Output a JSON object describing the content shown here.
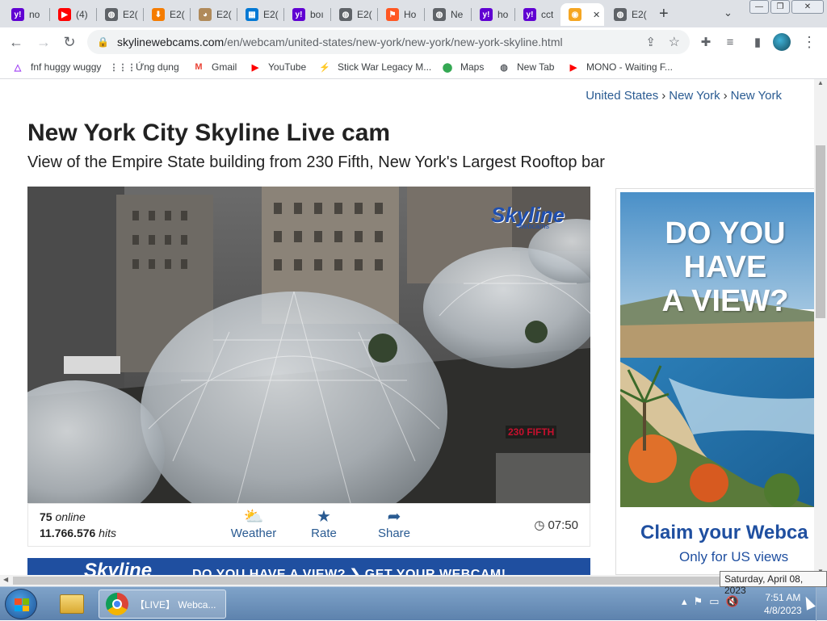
{
  "tabs": [
    {
      "title": "no",
      "icon": "yahoo-icon",
      "color": "#6001d2",
      "glyph": "y!"
    },
    {
      "title": "(4)",
      "icon": "youtube-icon",
      "color": "#ff0000",
      "glyph": "▶"
    },
    {
      "title": "E2(",
      "icon": "globe-icon",
      "color": "#5f6368",
      "glyph": "◍"
    },
    {
      "title": "E2(",
      "icon": "download-arrow-icon",
      "color": "#f57c00",
      "glyph": "⬇"
    },
    {
      "title": "E2(",
      "icon": "cat-icon",
      "color": "#b08a5a",
      "glyph": "◕"
    },
    {
      "title": "E2(",
      "icon": "windows-icon",
      "color": "#0078d4",
      "glyph": "▦"
    },
    {
      "title": "boı",
      "icon": "yahoo-icon",
      "color": "#6001d2",
      "glyph": "y!"
    },
    {
      "title": "E2(",
      "icon": "globe-icon",
      "color": "#5f6368",
      "glyph": "◍"
    },
    {
      "title": "Ho",
      "icon": "flag-icon",
      "color": "#ff5722",
      "glyph": "⚑"
    },
    {
      "title": "Ne",
      "icon": "globe-icon",
      "color": "#5f6368",
      "glyph": "◍"
    },
    {
      "title": "ho",
      "icon": "yahoo-icon",
      "color": "#6001d2",
      "glyph": "y!"
    },
    {
      "title": "cct",
      "icon": "yahoo-icon",
      "color": "#6001d2",
      "glyph": "y!"
    },
    {
      "title": "",
      "icon": "skyline-webcams-icon",
      "color": "#f5a623",
      "glyph": "◉",
      "active": true
    },
    {
      "title": "E2(",
      "icon": "globe-icon",
      "color": "#5f6368",
      "glyph": "◍"
    }
  ],
  "toolbar": {
    "url_domain": "skylinewebcams.com",
    "url_path": "/en/webcam/united-states/new-york/new-york/new-york-skyline.html"
  },
  "bookmarks": [
    {
      "label": "fnf huggy wuggy",
      "icon": "triangle-icon",
      "glyph": "△",
      "color": "#a142f4"
    },
    {
      "label": "Ứng dụng",
      "icon": "apps-grid-icon",
      "glyph": "⋮⋮⋮",
      "color": "#5f6368"
    },
    {
      "label": "Gmail",
      "icon": "gmail-icon",
      "glyph": "M",
      "color": "#ea4335"
    },
    {
      "label": "YouTube",
      "icon": "youtube-icon",
      "glyph": "▶",
      "color": "#ff0000"
    },
    {
      "label": "Stick War Legacy M...",
      "icon": "stickwar-icon",
      "glyph": "⚡",
      "color": "#34a853"
    },
    {
      "label": "Maps",
      "icon": "maps-pin-icon",
      "glyph": "⬤",
      "color": "#34a853"
    },
    {
      "label": "New Tab",
      "icon": "globe-icon",
      "glyph": "◍",
      "color": "#5f6368"
    },
    {
      "label": "MONO - Waiting F...",
      "icon": "youtube-icon",
      "glyph": "▶",
      "color": "#ff0000"
    }
  ],
  "breadcrumb": [
    "United States",
    "New York",
    "New York"
  ],
  "page": {
    "title": "New York City Skyline Live cam",
    "subtitle": "View of the Empire State building from 230 Fifth, New York's Largest Rooftop bar"
  },
  "webcam": {
    "watermark": "Skyline",
    "watermark_sub": "webcams",
    "overlay": "230 FIFTH"
  },
  "info": {
    "online_count": "75",
    "online_label": " online",
    "hits_count": "11.766.576",
    "hits_label": " hits",
    "actions": [
      {
        "label": "Weather",
        "icon": "weather-cloud-icon",
        "glyph": "⛅"
      },
      {
        "label": "Rate",
        "icon": "star-icon",
        "glyph": "★"
      },
      {
        "label": "Share",
        "icon": "share-arrow-icon",
        "glyph": "➦"
      }
    ],
    "time": "07:50"
  },
  "banner": {
    "logo": "Skyline",
    "text": "DO YOU HAVE A VIEW?  ❯  GET YOUR WEBCAM!"
  },
  "ad": {
    "headline_1": "DO YOU HAVE",
    "headline_2": "A VIEW?",
    "claim": "Claim your Webca",
    "only": "Only for US views"
  },
  "taskbar": {
    "chrome_label": "【LIVE】 Webca...",
    "time": "7:51 AM",
    "date": "4/8/2023",
    "tooltip": "Saturday, April 08, 2023"
  }
}
